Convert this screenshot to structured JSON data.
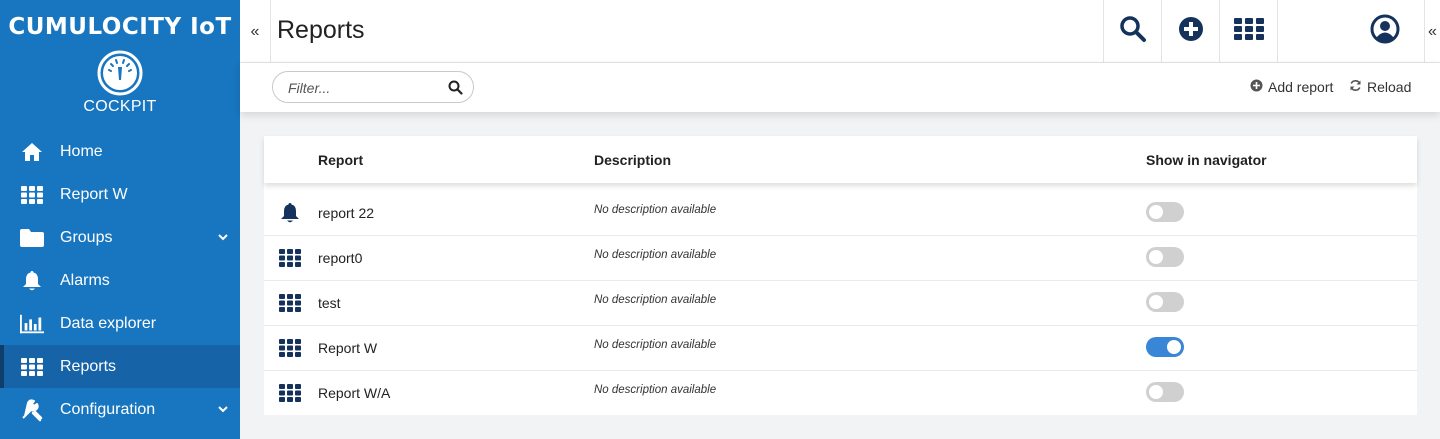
{
  "brand": {
    "title": "CUMULOCITY IoT",
    "app": "COCKPIT"
  },
  "sidebar": {
    "items": [
      {
        "label": "Home",
        "icon": "home-icon",
        "active": false,
        "expandable": false
      },
      {
        "label": "Report W",
        "icon": "grid-icon",
        "active": false,
        "expandable": false
      },
      {
        "label": "Groups",
        "icon": "folder-icon",
        "active": false,
        "expandable": true
      },
      {
        "label": "Alarms",
        "icon": "bell-icon",
        "active": false,
        "expandable": false
      },
      {
        "label": "Data explorer",
        "icon": "bar-chart-icon",
        "active": false,
        "expandable": false
      },
      {
        "label": "Reports",
        "icon": "grid-icon",
        "active": true,
        "expandable": false
      },
      {
        "label": "Configuration",
        "icon": "wrench-icon",
        "active": false,
        "expandable": true
      }
    ]
  },
  "header": {
    "collapse_glyph": "«",
    "title": "Reports"
  },
  "actions": {
    "filter_placeholder": "Filter...",
    "add_report": "Add report",
    "reload": "Reload"
  },
  "table": {
    "columns": {
      "report": "Report",
      "description": "Description",
      "navigator": "Show in navigator"
    },
    "rows": [
      {
        "icon": "bell-icon",
        "name": "report 22",
        "description": "No description available",
        "show_in_navigator": false
      },
      {
        "icon": "grid-icon",
        "name": "report0",
        "description": "No description available",
        "show_in_navigator": false
      },
      {
        "icon": "grid-icon",
        "name": "test",
        "description": "No description available",
        "show_in_navigator": false
      },
      {
        "icon": "grid-icon",
        "name": "Report W",
        "description": "No description available",
        "show_in_navigator": true
      },
      {
        "icon": "grid-icon",
        "name": "Report W/A",
        "description": "No description available",
        "show_in_navigator": false
      }
    ]
  },
  "colors": {
    "sidebar_bg": "#1776bf",
    "sidebar_active": "#1663a7",
    "icon_dark": "#14325c",
    "toggle_on": "#3a86d6",
    "toggle_off": "#d0d0d0"
  }
}
